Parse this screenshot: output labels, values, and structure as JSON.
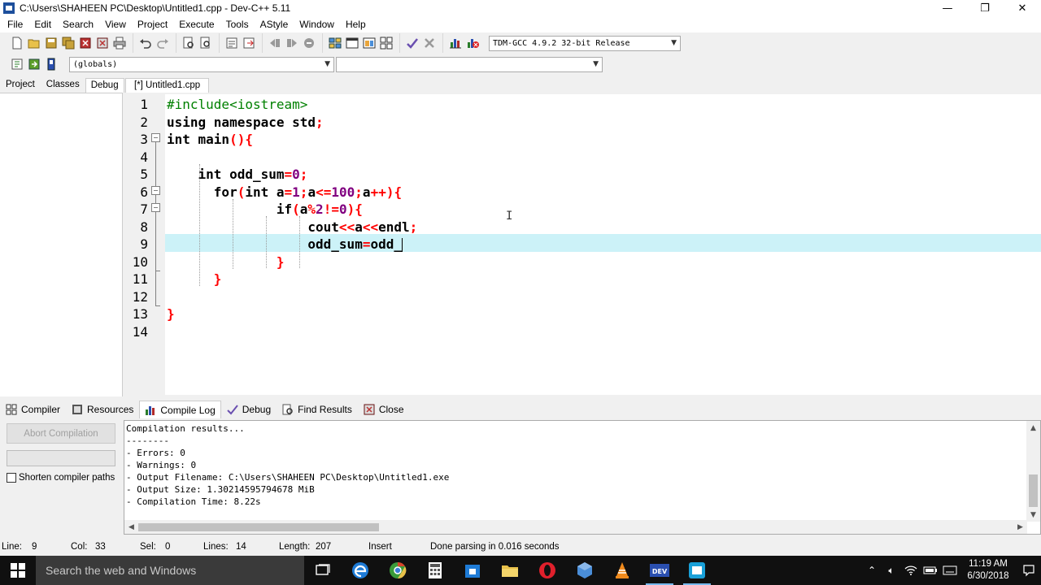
{
  "window": {
    "title": "C:\\Users\\SHAHEEN PC\\Desktop\\Untitled1.cpp - Dev-C++ 5.11",
    "minimize": "—",
    "restore": "❐",
    "close": "✕"
  },
  "menu": [
    "File",
    "Edit",
    "Search",
    "View",
    "Project",
    "Execute",
    "Tools",
    "AStyle",
    "Window",
    "Help"
  ],
  "toolbar": {
    "compiler_select": "TDM-GCC 4.9.2 32-bit Release",
    "scope_select": "(globals)",
    "member_select": ""
  },
  "left_tabs": [
    "Project",
    "Classes",
    "Debug"
  ],
  "editor_tab": "[*] Untitled1.cpp",
  "editor": {
    "line_numbers": [
      "1",
      "2",
      "3",
      "4",
      "5",
      "6",
      "7",
      "8",
      "9",
      "10",
      "11",
      "12",
      "13",
      "14"
    ],
    "lines": [
      "#include<iostream>",
      "using namespace std;",
      "int main(){",
      "",
      "    int odd_sum=0;",
      "      for(int a=1;a<=100;a++){",
      "              if(a%2!=0){",
      "                  cout<<a<<endl;",
      "                  odd_sum=odd_",
      "              }",
      "      }",
      "",
      "}",
      ""
    ]
  },
  "bottom_tabs": [
    "Compiler",
    "Resources",
    "Compile Log",
    "Debug",
    "Find Results",
    "Close"
  ],
  "compile": {
    "abort_button": "Abort Compilation",
    "shorten_label": "Shorten compiler paths",
    "log": [
      "Compilation results...",
      "--------",
      "- Errors: 0",
      "- Warnings: 0",
      "- Output Filename: C:\\Users\\SHAHEEN PC\\Desktop\\Untitled1.exe",
      "- Output Size: 1.30214595794678 MiB",
      "- Compilation Time: 8.22s"
    ]
  },
  "status": {
    "line_label": "Line:",
    "line": "9",
    "col_label": "Col:",
    "col": "33",
    "sel_label": "Sel:",
    "sel": "0",
    "lines_label": "Lines:",
    "lines": "14",
    "length_label": "Length:",
    "length": "207",
    "mode": "Insert",
    "message": "Done parsing in 0.016 seconds"
  },
  "taskbar": {
    "search_placeholder": "Search the web and Windows",
    "time": "11:19 AM",
    "date": "6/30/2018"
  },
  "colors": {
    "keyword": "#000000",
    "preprocessor": "#008000",
    "symbol": "#ff0000",
    "number": "#800080",
    "active_line": "#ccf2f8",
    "taskbar": "#101010"
  }
}
